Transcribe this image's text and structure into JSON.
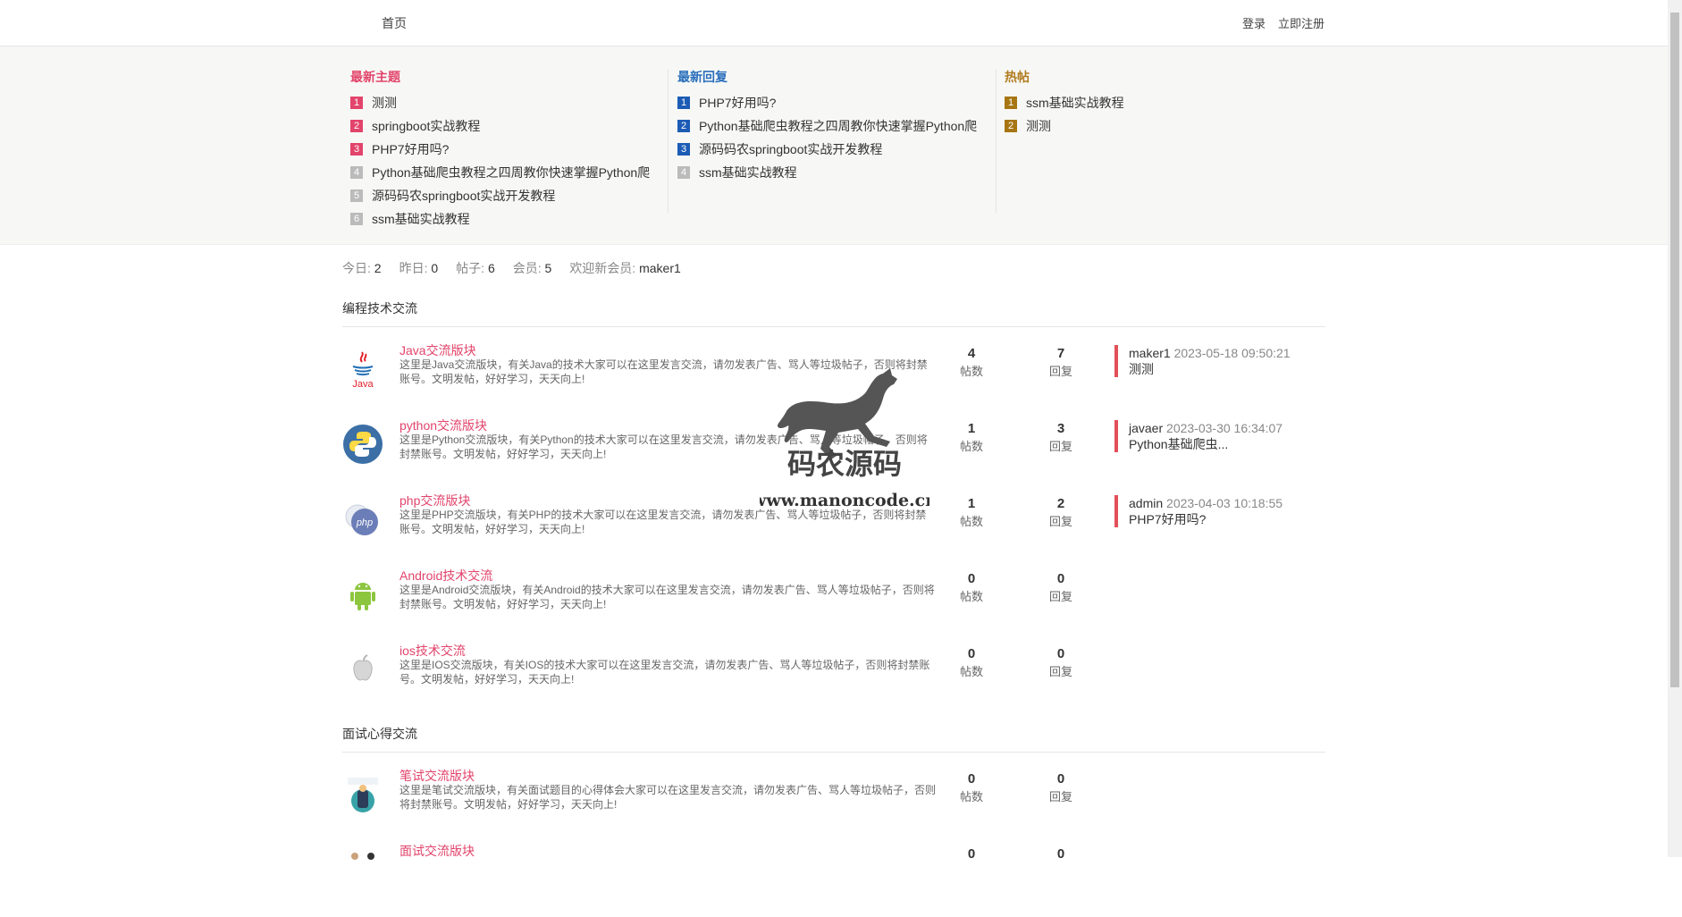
{
  "nav": {
    "home": "首页",
    "login": "登录",
    "register": "立即注册"
  },
  "latest_topics": {
    "title": "最新主题",
    "items": [
      {
        "rank": "1",
        "text": "测测"
      },
      {
        "rank": "2",
        "text": "springboot实战教程"
      },
      {
        "rank": "3",
        "text": "PHP7好用吗?"
      },
      {
        "rank": "4",
        "text": "Python基础爬虫教程之四周教你快速掌握Python爬"
      },
      {
        "rank": "5",
        "text": "源码码农springboot实战开发教程"
      },
      {
        "rank": "6",
        "text": "ssm基础实战教程"
      }
    ]
  },
  "latest_replies": {
    "title": "最新回复",
    "items": [
      {
        "rank": "1",
        "text": "PHP7好用吗?"
      },
      {
        "rank": "2",
        "text": "Python基础爬虫教程之四周教你快速掌握Python爬"
      },
      {
        "rank": "3",
        "text": "源码码农springboot实战开发教程"
      },
      {
        "rank": "4",
        "text": "ssm基础实战教程"
      }
    ]
  },
  "hot_posts": {
    "title": "热帖",
    "items": [
      {
        "rank": "1",
        "text": "ssm基础实战教程"
      },
      {
        "rank": "2",
        "text": "测测"
      }
    ]
  },
  "stats": {
    "today_label": "今日:",
    "today": "2",
    "yesterday_label": "昨日:",
    "yesterday": "0",
    "posts_label": "帖子:",
    "posts": "6",
    "members_label": "会员:",
    "members": "5",
    "welcome_label": "欢迎新会员:",
    "new_member": "maker1"
  },
  "sections": [
    {
      "title": "编程技术交流",
      "forums": [
        {
          "name": "Java交流版块",
          "icon": "java-icon",
          "desc": "这里是Java交流版块，有关Java的技术大家可以在这里发言交流，请勿发表广告、骂人等垃圾帖子，否则将封禁账号。文明发帖，好好学习，天天向上!",
          "posts": "4",
          "replies": "7",
          "last_user": "maker1",
          "last_time": "2023-05-18 09:50:21",
          "last_title": "测测"
        },
        {
          "name": "python交流版块",
          "icon": "python-icon",
          "desc": "这里是Python交流版块，有关Python的技术大家可以在这里发言交流，请勿发表广告、骂人等垃圾帖子，否则将封禁账号。文明发帖，好好学习，天天向上!",
          "posts": "1",
          "replies": "3",
          "last_user": "javaer",
          "last_time": "2023-03-30 16:34:07",
          "last_title": "Python基础爬虫..."
        },
        {
          "name": "php交流版块",
          "icon": "php-icon",
          "desc": "这里是PHP交流版块，有关PHP的技术大家可以在这里发言交流，请勿发表广告、骂人等垃圾帖子，否则将封禁账号。文明发帖，好好学习，天天向上!",
          "posts": "1",
          "replies": "2",
          "last_user": "admin",
          "last_time": "2023-04-03 10:18:55",
          "last_title": "PHP7好用吗?"
        },
        {
          "name": "Android技术交流",
          "icon": "android-icon",
          "desc": "这里是Android交流版块，有关Android的技术大家可以在这里发言交流，请勿发表广告、骂人等垃圾帖子，否则将封禁账号。文明发帖，好好学习，天天向上!",
          "posts": "0",
          "replies": "0"
        },
        {
          "name": "ios技术交流",
          "icon": "apple-icon",
          "desc": "这里是IOS交流版块，有关IOS的技术大家可以在这里发言交流，请勿发表广告、骂人等垃圾帖子，否则将封禁账号。文明发帖，好好学习，天天向上!",
          "posts": "0",
          "replies": "0"
        }
      ]
    },
    {
      "title": "面试心得交流",
      "forums": [
        {
          "name": "笔试交流版块",
          "icon": "written-test-icon",
          "desc": "这里是笔试交流版块，有关面试题目的心得体会大家可以在这里发言交流，请勿发表广告、骂人等垃圾帖子，否则将封禁账号。文明发帖，好好学习，天天向上!",
          "posts": "0",
          "replies": "0"
        },
        {
          "name": "面试交流版块",
          "icon": "interview-icon",
          "posts": "0",
          "replies": "0"
        }
      ]
    }
  ],
  "labels": {
    "posts": "帖数",
    "replies": "回复"
  },
  "watermark": {
    "cn": "码农源码",
    "url": "www.manoncode.cn"
  }
}
